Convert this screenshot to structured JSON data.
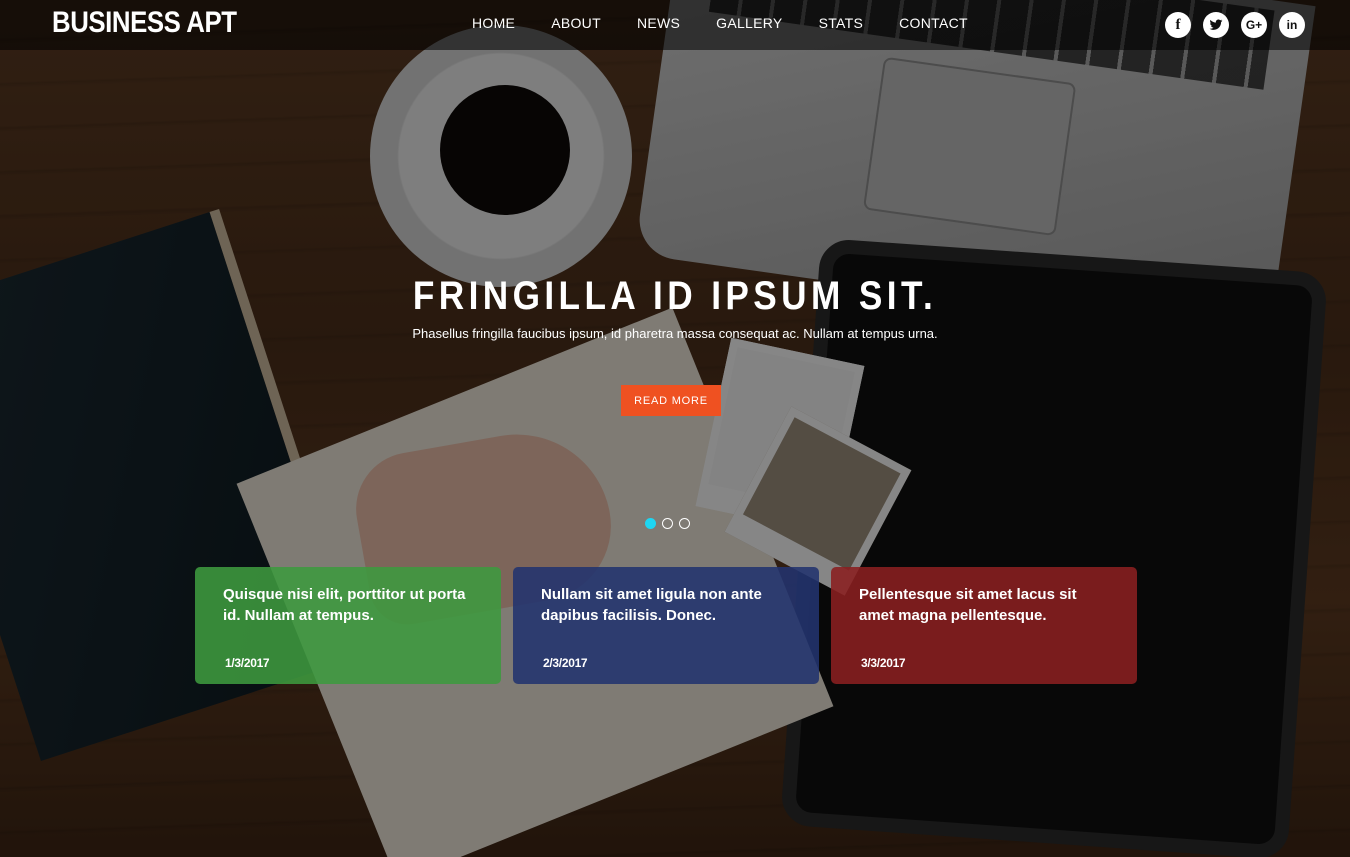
{
  "brand": {
    "name": "BUSINESS APT"
  },
  "nav": {
    "items": [
      {
        "label": "HOME"
      },
      {
        "label": "ABOUT"
      },
      {
        "label": "NEWS"
      },
      {
        "label": "GALLERY"
      },
      {
        "label": "STATS"
      },
      {
        "label": "CONTACT"
      }
    ]
  },
  "social": {
    "items": [
      {
        "icon": "facebook-icon",
        "glyph": "f"
      },
      {
        "icon": "twitter-icon",
        "glyph": ""
      },
      {
        "icon": "google-plus-icon",
        "glyph": "G+"
      },
      {
        "icon": "linkedin-icon",
        "glyph": "in"
      }
    ]
  },
  "hero": {
    "title": "FRINGILLA ID IPSUM SIT.",
    "subtitle": "Phasellus fringilla faucibus ipsum, id pharetra massa consequat ac. Nullam at tempus urna.",
    "button_label": "READ MORE",
    "slides_total": 3,
    "slide_active": 1
  },
  "cards": [
    {
      "text": "Quisque nisi elit, porttitor ut porta id. Nullam at tempus.",
      "date": "1/3/2017",
      "color": "#3d9a3f"
    },
    {
      "text": "Nullam sit amet ligula non ante dapibus facilisis. Donec.",
      "date": "2/3/2017",
      "color": "#22336e"
    },
    {
      "text": "Pellentesque sit amet lacus sit amet magna pellentesque.",
      "date": "3/3/2017",
      "color": "#8a1f20"
    }
  ],
  "colors": {
    "accent": "#ef5121",
    "dot_active": "#1ed6f2"
  }
}
